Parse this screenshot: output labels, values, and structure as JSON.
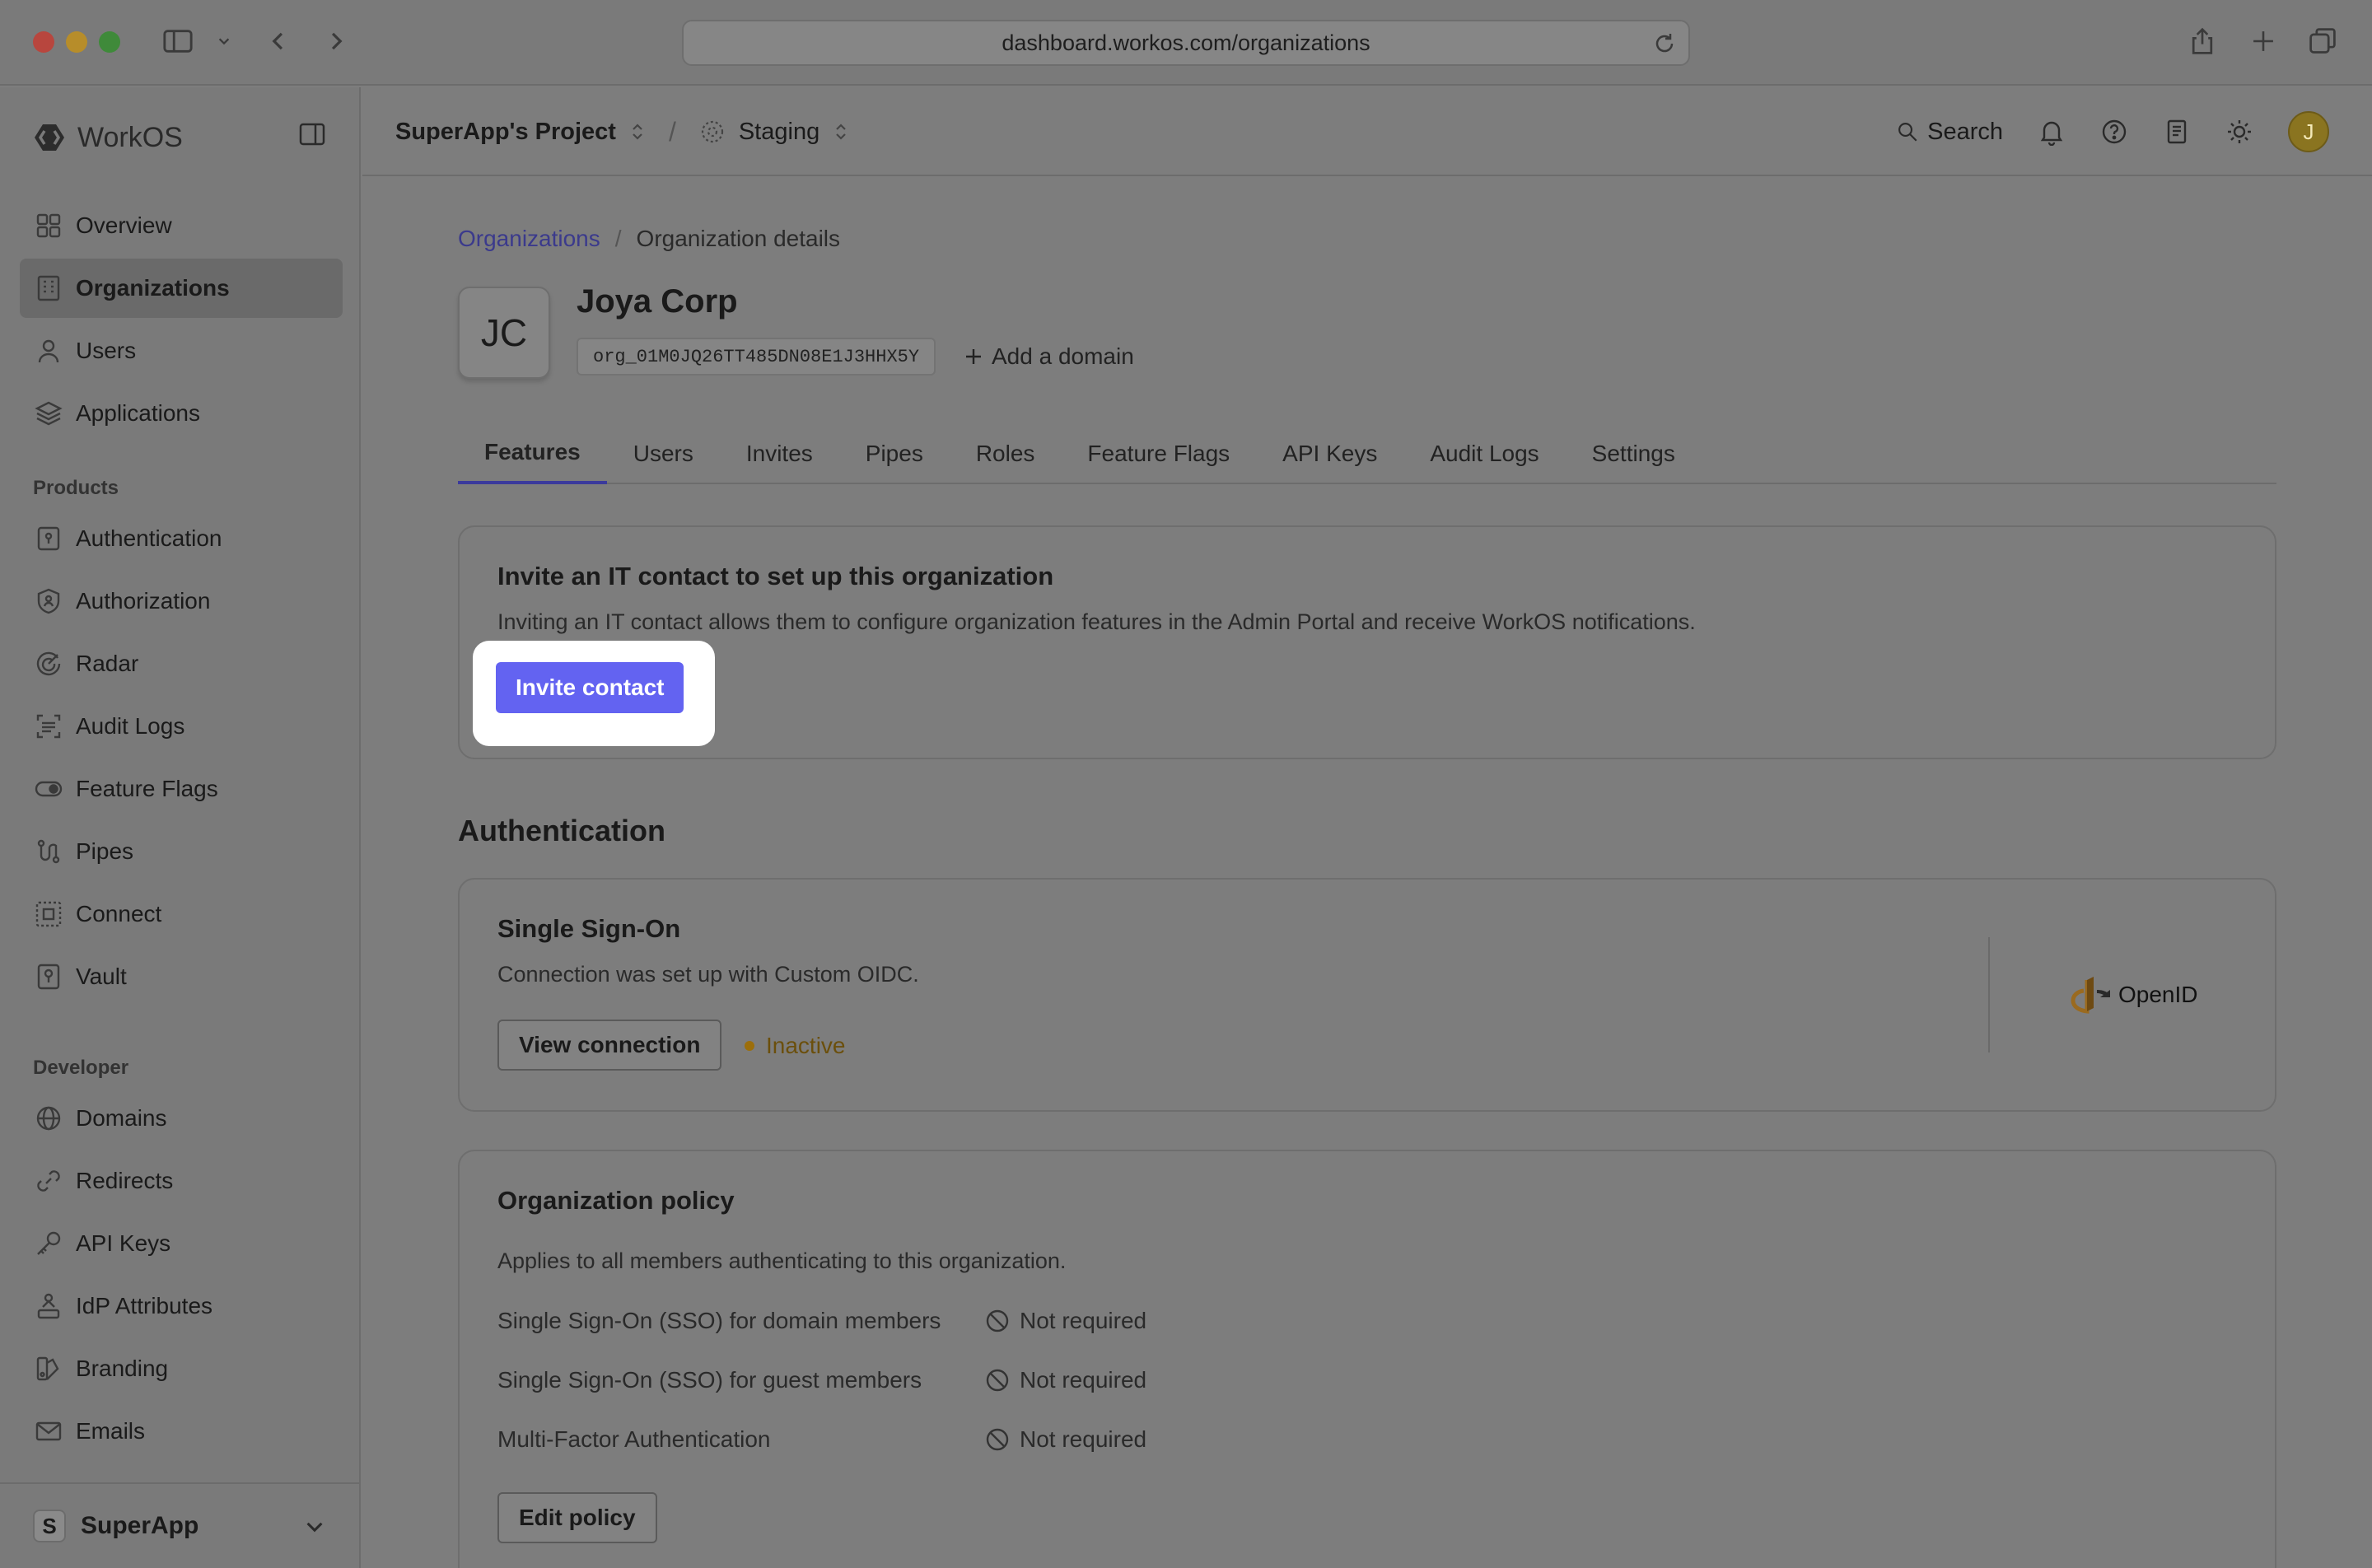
{
  "browser": {
    "url": "dashboard.workos.com/organizations"
  },
  "sidebar": {
    "brand": "WorkOS",
    "items": [
      {
        "label": "Overview",
        "icon": "grid-icon"
      },
      {
        "label": "Organizations",
        "icon": "building-icon"
      },
      {
        "label": "Users",
        "icon": "user-icon"
      },
      {
        "label": "Applications",
        "icon": "layers-icon"
      }
    ],
    "products_heading": "Products",
    "products": [
      {
        "label": "Authentication",
        "icon": "auth-icon"
      },
      {
        "label": "Authorization",
        "icon": "shield-icon"
      },
      {
        "label": "Radar",
        "icon": "radar-icon"
      },
      {
        "label": "Audit Logs",
        "icon": "audit-icon"
      },
      {
        "label": "Feature Flags",
        "icon": "toggle-icon"
      },
      {
        "label": "Pipes",
        "icon": "pipes-icon"
      },
      {
        "label": "Connect",
        "icon": "connect-icon"
      },
      {
        "label": "Vault",
        "icon": "vault-icon"
      }
    ],
    "developer_heading": "Developer",
    "developer": [
      {
        "label": "Domains",
        "icon": "globe-icon"
      },
      {
        "label": "Redirects",
        "icon": "link-icon"
      },
      {
        "label": "API Keys",
        "icon": "key-icon"
      },
      {
        "label": "IdP Attributes",
        "icon": "attributes-icon"
      },
      {
        "label": "Branding",
        "icon": "branding-icon"
      },
      {
        "label": "Emails",
        "icon": "mail-icon"
      }
    ],
    "workspace": {
      "initial": "S",
      "name": "SuperApp"
    }
  },
  "topbar": {
    "project": "SuperApp's Project",
    "environment": "Staging",
    "search_label": "Search",
    "avatar_initial": "J"
  },
  "breadcrumb": {
    "parent": "Organizations",
    "separator": "/",
    "current": "Organization details"
  },
  "org": {
    "initials": "JC",
    "name": "Joya Corp",
    "id": "org_01M0JQ26TT485DN08E1J3HHX5Y",
    "add_domain": "Add a domain"
  },
  "tabs": [
    "Features",
    "Users",
    "Invites",
    "Pipes",
    "Roles",
    "Feature Flags",
    "API Keys",
    "Audit Logs",
    "Settings"
  ],
  "invite_card": {
    "title": "Invite an IT contact to set up this organization",
    "description": "Inviting an IT contact allows them to configure organization features in the Admin Portal and receive WorkOS notifications.",
    "button": "Invite contact"
  },
  "authentication": {
    "heading": "Authentication",
    "sso": {
      "title": "Single Sign-On",
      "description": "Connection was set up with Custom OIDC.",
      "button": "View connection",
      "status": "Inactive",
      "provider": "OpenID"
    }
  },
  "policy": {
    "title": "Organization policy",
    "description": "Applies to all members authenticating to this organization.",
    "rows": [
      {
        "label": "Single Sign-On (SSO) for domain members",
        "value": "Not required"
      },
      {
        "label": "Single Sign-On (SSO) for guest members",
        "value": "Not required"
      },
      {
        "label": "Multi-Factor Authentication",
        "value": "Not required"
      }
    ],
    "button": "Edit policy"
  },
  "colors": {
    "accent": "#6363f1",
    "link": "#3b3a8c",
    "status_inactive": "#9c6e0a"
  }
}
